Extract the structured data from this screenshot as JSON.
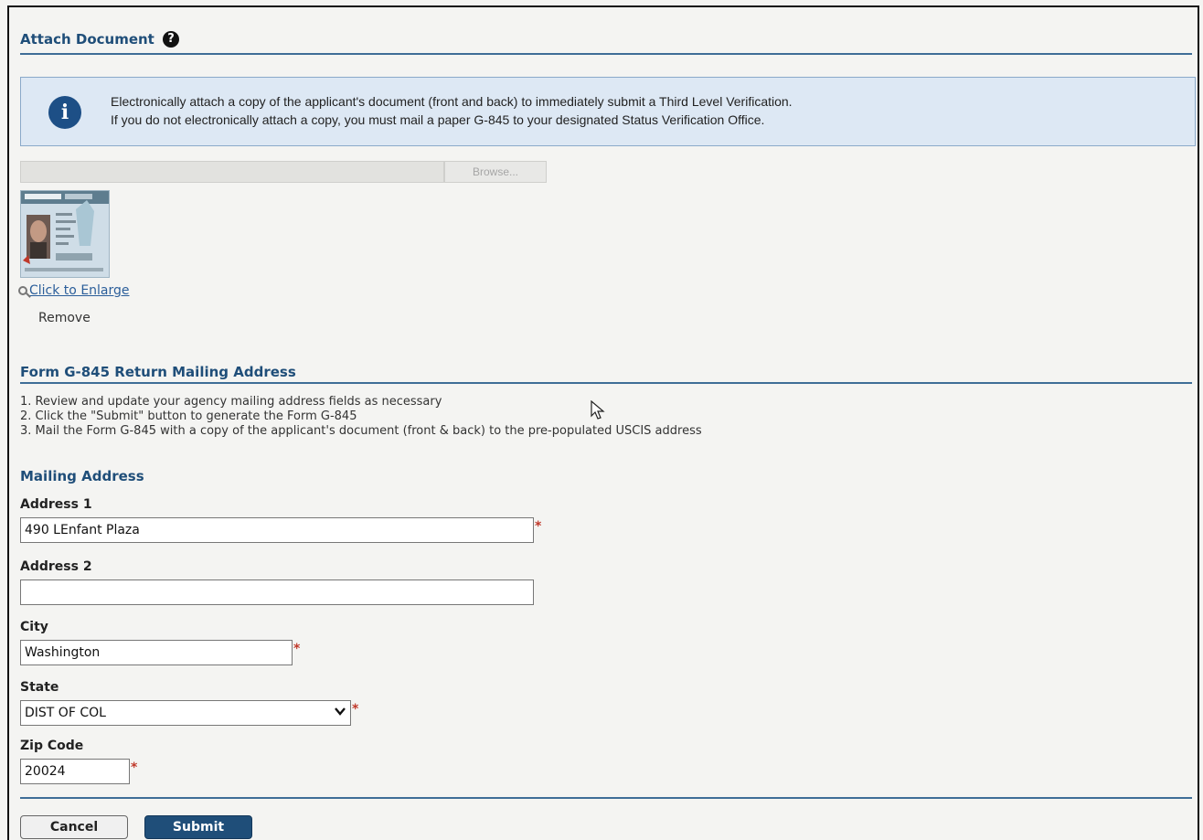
{
  "attach_section": {
    "title": "Attach Document",
    "help_icon": "?",
    "info_line1": "Electronically attach a copy of the applicant's document (front and back) to immediately submit a Third Level Verification.",
    "info_line2": "If you do not electronically attach a copy, you must mail a paper G-845 to your designated Status Verification Office.",
    "browse_label": "Browse...",
    "enlarge_link": "Click to Enlarge",
    "remove_label": "Remove"
  },
  "g845_section": {
    "title": "Form G-845 Return Mailing Address",
    "steps": [
      "1. Review and update your agency mailing address fields as necessary",
      "2. Click the \"Submit\" button to generate the Form G-845",
      "3. Mail the Form G-845 with a copy of the applicant's document (front & back) to the pre-populated USCIS address"
    ]
  },
  "mailing_address": {
    "title": "Mailing Address",
    "address1": {
      "label": "Address 1",
      "value": "490 LEnfant Plaza"
    },
    "address2": {
      "label": "Address 2",
      "value": ""
    },
    "city": {
      "label": "City",
      "value": "Washington"
    },
    "state": {
      "label": "State",
      "value": "DIST OF COL"
    },
    "zip": {
      "label": "Zip Code",
      "value": "20024"
    },
    "required_marker": "*"
  },
  "actions": {
    "cancel_label": "Cancel",
    "submit_label": "Submit"
  },
  "colors": {
    "heading": "#1f4e79",
    "info_bg": "#dde8f4",
    "submit_bg": "#1f4e79",
    "required": "#c0392b"
  }
}
